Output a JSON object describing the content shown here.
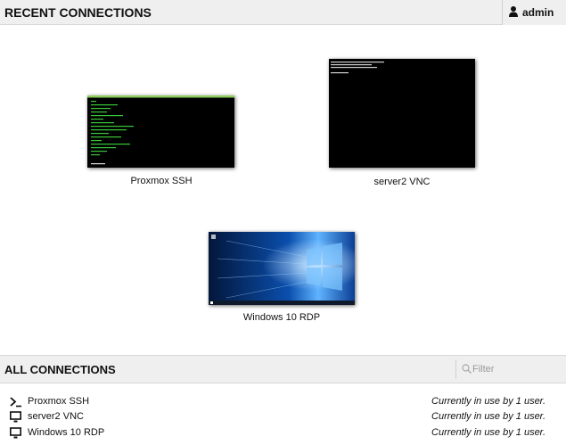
{
  "header": {
    "title": "RECENT CONNECTIONS",
    "user": "admin"
  },
  "recent": [
    {
      "label": "Proxmox SSH",
      "thumb": "terminal-ssh"
    },
    {
      "label": "server2 VNC",
      "thumb": "terminal-vnc"
    },
    {
      "label": "Windows 10 RDP",
      "thumb": "windows-desktop"
    }
  ],
  "all_connections": {
    "title": "ALL CONNECTIONS",
    "filter_placeholder": "Filter",
    "items": [
      {
        "name": "Proxmox SSH",
        "status": "Currently in use by 1 user.",
        "icon": "terminal-icon"
      },
      {
        "name": "server2 VNC",
        "status": "Currently in use by 1 user.",
        "icon": "monitor-icon"
      },
      {
        "name": "Windows 10 RDP",
        "status": "Currently in use by 1 user.",
        "icon": "monitor-icon"
      }
    ]
  },
  "colors": {
    "header_bg": "#efefef",
    "terminal_green": "#39c739",
    "windows_blue": "#0a5cc4"
  }
}
